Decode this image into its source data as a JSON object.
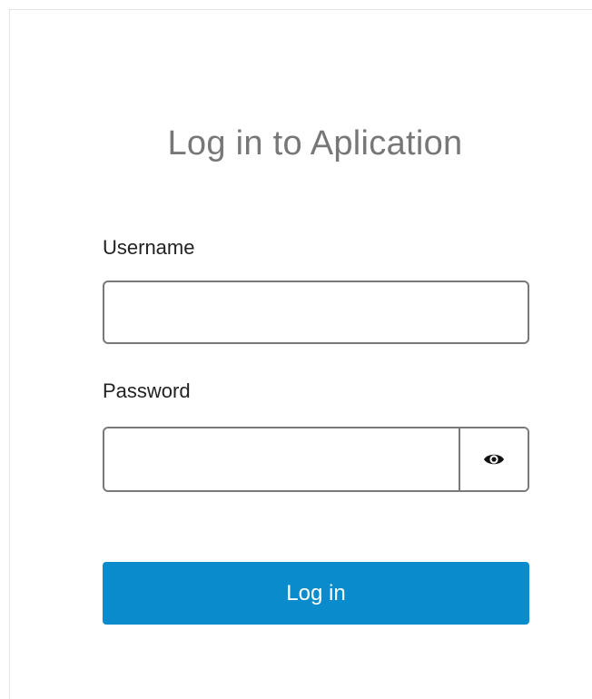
{
  "login": {
    "title": "Log in to Aplication",
    "username": {
      "label": "Username",
      "value": "",
      "placeholder": ""
    },
    "password": {
      "label": "Password",
      "value": "",
      "placeholder": "",
      "toggle_icon": "eye-icon"
    },
    "submit_label": "Log in"
  },
  "colors": {
    "accent": "#0a8bcc",
    "title": "#777777",
    "border": "#7a7a7a"
  }
}
